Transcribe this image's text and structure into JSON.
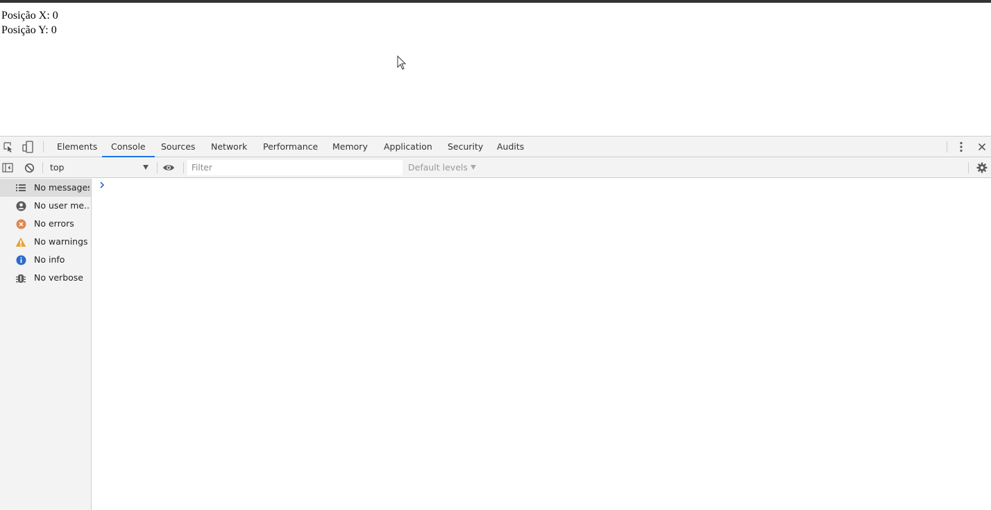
{
  "page": {
    "position_x_label": "Posição X: 0",
    "position_y_label": "Posição Y: 0"
  },
  "devtools": {
    "tabs": [
      {
        "label": "Elements",
        "active": false
      },
      {
        "label": "Console",
        "active": true
      },
      {
        "label": "Sources",
        "active": false
      },
      {
        "label": "Network",
        "active": false
      },
      {
        "label": "Performance",
        "active": false
      },
      {
        "label": "Memory",
        "active": false
      },
      {
        "label": "Application",
        "active": false
      },
      {
        "label": "Security",
        "active": false
      },
      {
        "label": "Audits",
        "active": false
      }
    ],
    "toolbar": {
      "context": "top",
      "filter_placeholder": "Filter",
      "levels": "Default levels"
    },
    "sidebar": {
      "items": [
        {
          "label": "No messages",
          "icon": "list-icon",
          "selected": true
        },
        {
          "label": "No user me...",
          "icon": "user-icon",
          "selected": false
        },
        {
          "label": "No errors",
          "icon": "error-icon",
          "selected": false
        },
        {
          "label": "No warnings",
          "icon": "warning-icon",
          "selected": false
        },
        {
          "label": "No info",
          "icon": "info-icon",
          "selected": false
        },
        {
          "label": "No verbose",
          "icon": "bug-icon",
          "selected": false
        }
      ]
    }
  },
  "colors": {
    "accent": "#1a73e8",
    "error": "#e0874f",
    "warning": "#e8a33d",
    "info": "#2f6ac8"
  }
}
